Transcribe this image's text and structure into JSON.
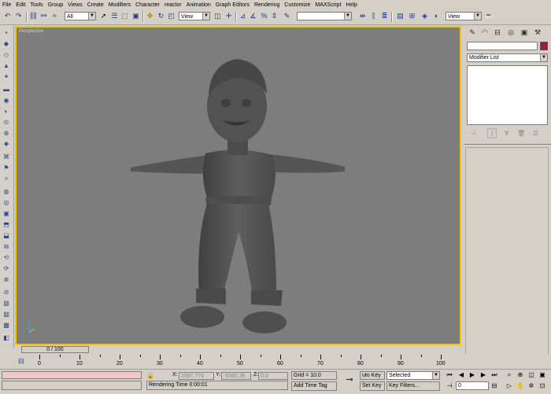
{
  "menu": [
    "File",
    "Edit",
    "Tools",
    "Group",
    "Views",
    "Create",
    "Modifiers",
    "Character",
    "reactor",
    "Animation",
    "Graph Editors",
    "Rendering",
    "Customize",
    "MAXScript",
    "Help"
  ],
  "toolbar": {
    "selection_filter": "All",
    "ref_coord": "View",
    "named_selection": "",
    "view_right": "View"
  },
  "viewport": {
    "label": "Perspective",
    "bg_color": "#7d7d7d",
    "border_color": "#f0c800"
  },
  "command_panel": {
    "name_field": "",
    "color_swatch": "#9c1a4a",
    "modifier_list": "Modifier List"
  },
  "timeline": {
    "frame_display": "0 / 100",
    "ticks": [
      "0",
      "10",
      "20",
      "30",
      "40",
      "50",
      "60",
      "70",
      "80",
      "90",
      "100"
    ]
  },
  "status": {
    "prompt": "Rendering Time  0:00:01",
    "x_label": "X:",
    "x_value": "1997.770",
    "y_label": "Y:",
    "y_value": "-5565.35",
    "z_label": "Z:",
    "z_value": "0.0",
    "grid": "Grid = 10.0",
    "add_time_tag": "Add Time Tag",
    "auto_key": "uto Key",
    "set_key": "Set Key",
    "key_mode": "Selected",
    "key_filters": "Key Filters...",
    "frame_field": "0"
  }
}
